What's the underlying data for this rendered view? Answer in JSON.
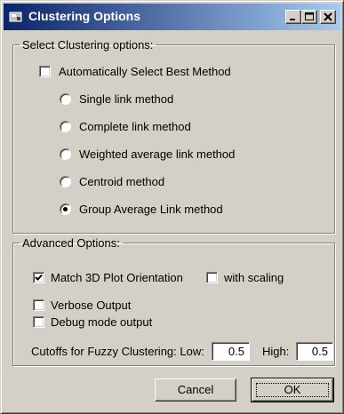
{
  "window": {
    "title": "Clustering Options"
  },
  "clustering": {
    "group_label": "Select Clustering options:",
    "auto_select": {
      "label": "Automatically Select Best Method",
      "checked": false
    },
    "methods": [
      {
        "label": "Single link method",
        "selected": false
      },
      {
        "label": "Complete link method",
        "selected": false
      },
      {
        "label": "Weighted average link method",
        "selected": false
      },
      {
        "label": "Centroid method",
        "selected": false
      },
      {
        "label": "Group Average Link method",
        "selected": true
      }
    ]
  },
  "advanced": {
    "group_label": "Advanced Options:",
    "match_3d": {
      "label": "Match 3D Plot Orientation",
      "checked": true
    },
    "with_scaling": {
      "label": "with scaling",
      "checked": false
    },
    "verbose": {
      "label": "Verbose Output",
      "checked": false
    },
    "debug": {
      "label": "Debug mode output",
      "checked": false
    },
    "cutoffs": {
      "label": "Cutoffs for Fuzzy Clustering: Low:",
      "low_value": "0.5",
      "high_label": "High:",
      "high_value": "0.5"
    }
  },
  "buttons": {
    "cancel": "Cancel",
    "ok": "OK"
  }
}
